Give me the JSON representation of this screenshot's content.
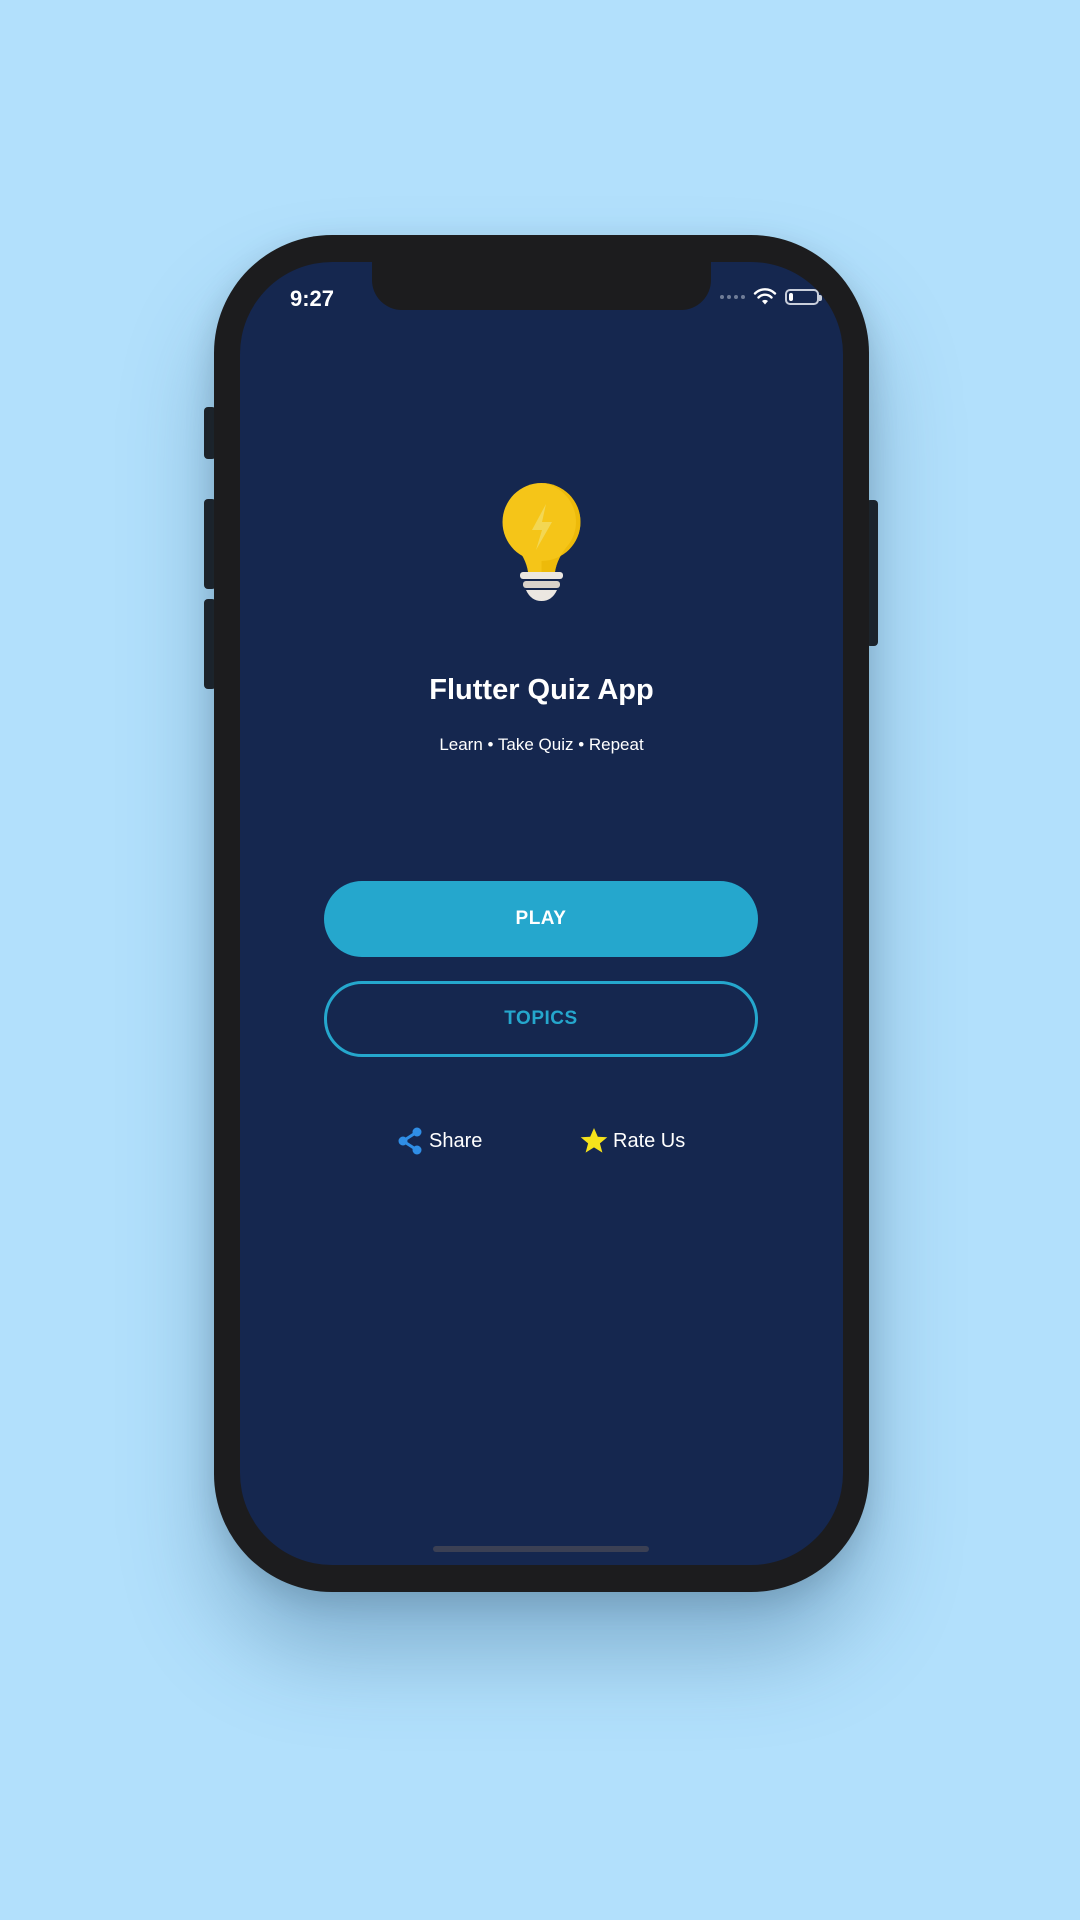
{
  "status_bar": {
    "time": "9:27",
    "icons": [
      "signal-icon",
      "wifi-icon",
      "battery-icon"
    ],
    "battery_level": 0.15
  },
  "app": {
    "logo_icon": "lightbulb-icon",
    "title": "Flutter Quiz App",
    "tagline": "Learn • Take Quiz • Repeat"
  },
  "actions": {
    "play_label": "PLAY",
    "topics_label": "TOPICS",
    "share_label": "Share",
    "share_icon": "share-icon",
    "rate_label": "Rate Us",
    "rate_icon": "star-icon"
  },
  "colors": {
    "page_background": "#b2e0fc",
    "screen_background": "#15274f",
    "accent": "#25a7cd",
    "bulb": "#f5c518",
    "share_icon": "#2f8ee6",
    "star": "#f5e21b",
    "text": "#ffffff"
  }
}
